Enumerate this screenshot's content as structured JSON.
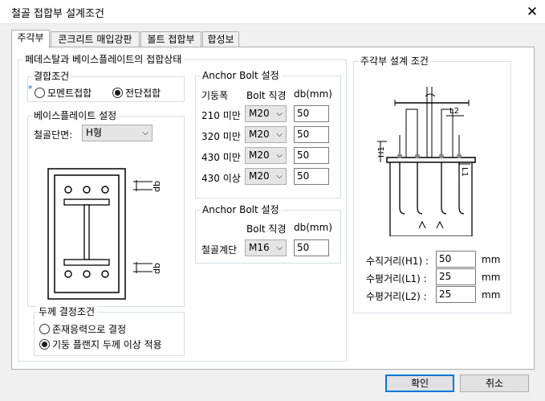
{
  "window": {
    "title": "철골 접합부 설계조건",
    "close_icon": "close-icon"
  },
  "tabs": [
    {
      "label": "주각부",
      "active": true
    },
    {
      "label": "콘크리트 매입강판"
    },
    {
      "label": "볼트 접합부"
    },
    {
      "label": "합성보"
    }
  ],
  "pedestal_group": {
    "title": "페데스탈과 베이스플레이트의 접합상태",
    "connection": {
      "title": "결합조건",
      "asterisk": "*",
      "options": [
        "모멘트접합",
        "전단접합"
      ],
      "selected": "전단접합"
    },
    "base_plate": {
      "title": "베이스플레이트 설정",
      "section_label": "철골단면:",
      "section_value": "H형",
      "dim_label_top": "db",
      "dim_label_bottom": "db"
    },
    "thickness": {
      "title": "두께 결정조건",
      "options": [
        "존재응력으로 결정",
        "기둥 플랜지 두께 이상 적용"
      ],
      "selected": "기둥 플랜지 두께 이상 적용"
    }
  },
  "anchor_bolt_1": {
    "title": "Anchor Bolt 설정",
    "col_width": "기둥폭",
    "col_bolt": "Bolt 직경",
    "col_db": "db(mm)",
    "rows": [
      {
        "label": "210 미만",
        "bolt": "M20",
        "db": "50"
      },
      {
        "label": "320 미만",
        "bolt": "M20",
        "db": "50"
      },
      {
        "label": "430 미만",
        "bolt": "M20",
        "db": "50"
      },
      {
        "label": "430 이상",
        "bolt": "M20",
        "db": "50"
      }
    ]
  },
  "anchor_bolt_2": {
    "title": "Anchor Bolt 설정",
    "col_bolt": "Bolt 직경",
    "col_db": "db(mm)",
    "row_label": "철골계단",
    "bolt": "M16",
    "db": "50"
  },
  "column_base": {
    "title": "주각부 설계 조건",
    "fig_labels": {
      "h1": "H1",
      "l1": "L1",
      "l2": "L2"
    },
    "fields": [
      {
        "label": "수직거리(H1) :",
        "value": "50",
        "unit": "mm"
      },
      {
        "label": "수평거리(L1) :",
        "value": "25",
        "unit": "mm"
      },
      {
        "label": "수평거리(L2) :",
        "value": "25",
        "unit": "mm"
      }
    ]
  },
  "buttons": {
    "ok": "확인",
    "cancel": "취소"
  }
}
